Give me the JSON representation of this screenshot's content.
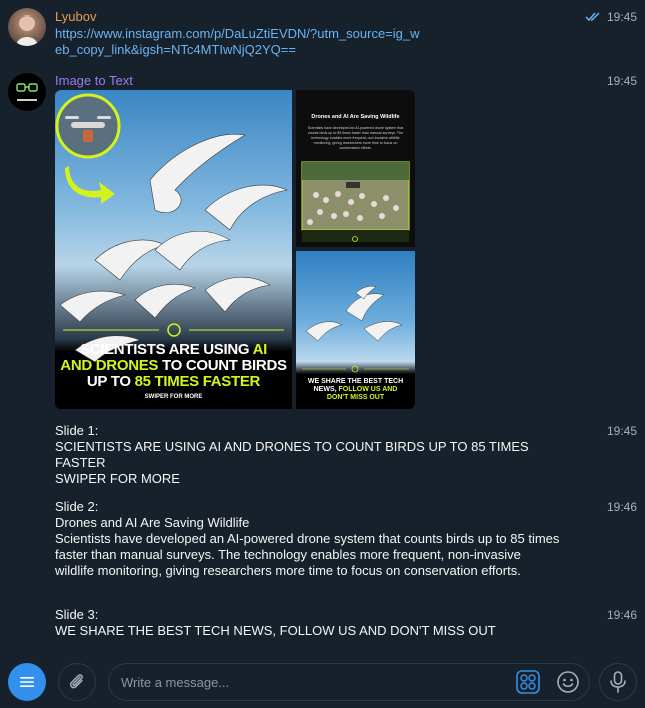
{
  "messages": [
    {
      "sender": "Lyubov",
      "sender_color": "#e79d4d",
      "time": "19:45",
      "link": "https://www.instagram.com/p/DaLuZtiEVDN/?utm_source=ig_web_copy_link&igsh=NTc4MTIwNjQ2YQ=="
    },
    {
      "sender": "Image to Text",
      "sender_color": "#9e7bf0",
      "time": "19:45",
      "avatar_label": "Image to Text",
      "images": {
        "main": {
          "headline_1": "SCIENTISTS ARE USING ",
          "headline_hl_1": "AI",
          "headline_2": "AND DRONES",
          "headline_3": " TO COUNT BIRDS",
          "headline_4": "UP TO ",
          "headline_hl_2": "85 TIMES FASTER",
          "footer": "SWIPER FOR MORE"
        },
        "top": {
          "title": "Drones and AI Are Saving Wildlife",
          "body": "Scientists have developed an AI-powered drone system that counts birds up to 85 times faster than manual surveys. The technology enables more frequent, non-invasive wildlife monitoring, giving researchers more time to focus on conservation efforts."
        },
        "bottom": {
          "line_1": "WE SHARE THE BEST TECH",
          "line_2a": "NEWS, ",
          "line_2b": "FOLLOW US AND",
          "line_3": "DON'T MISS OUT"
        }
      }
    },
    {
      "time": "19:45",
      "lines": [
        "Slide 1:",
        "SCIENTISTS ARE USING AI AND DRONES TO COUNT BIRDS UP TO 85 TIMES FASTER",
        "SWIPER FOR MORE"
      ]
    },
    {
      "time": "19:46",
      "lines": [
        "Slide 2:",
        "Drones and AI Are Saving Wildlife",
        "Scientists have developed an AI-powered drone system that counts birds up to 85 times faster than manual surveys. The technology enables more frequent, non-invasive wildlife monitoring, giving researchers more time to focus on conservation efforts."
      ]
    },
    {
      "time": "19:46",
      "lines": [
        "Slide 3:",
        "WE SHARE THE BEST TECH NEWS, FOLLOW US AND DON'T MISS OUT"
      ]
    }
  ],
  "composer": {
    "placeholder": "Write a message..."
  },
  "colors": {
    "background": "#17212b",
    "link": "#6ab3f3",
    "accent_blue": "#3390ec",
    "highlight_yellow": "#d4f31c"
  },
  "icons": {
    "menu": "menu-icon",
    "attach": "paperclip-icon",
    "stickers": "sticker-grid-icon",
    "emoji": "emoji-icon",
    "mic": "microphone-icon",
    "read": "double-check-icon"
  }
}
